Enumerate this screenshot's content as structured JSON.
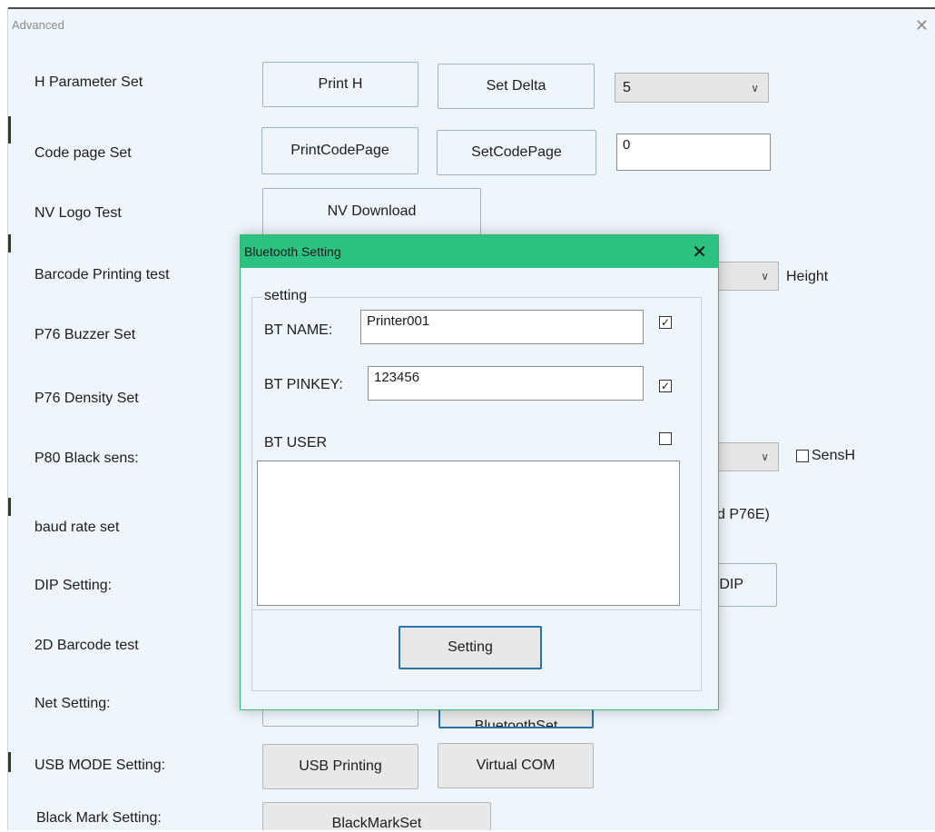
{
  "window": {
    "title": "Advanced",
    "close_glyph": "✕"
  },
  "rows": [
    {
      "label": "H Parameter Set"
    },
    {
      "label": "Code page Set"
    },
    {
      "label": "NV Logo Test"
    },
    {
      "label": "Barcode Printing test"
    },
    {
      "label": "P76 Buzzer Set"
    },
    {
      "label": "P76 Density Set"
    },
    {
      "label": "P80 Black sens:"
    },
    {
      "label": "baud rate set"
    },
    {
      "label": "DIP Setting:"
    },
    {
      "label": "2D Barcode test"
    },
    {
      "label": "Net Setting:"
    },
    {
      "label": "USB MODE Setting:"
    },
    {
      "label": "Black Mark Setting:"
    }
  ],
  "buttons": {
    "print_h": "Print H",
    "set_delta": "Set Delta",
    "print_code_page": "PrintCodePage",
    "set_code_page": "SetCodePage",
    "nv_download": "NV Download",
    "dip_partial": "DIP",
    "bluetooth_set_partial": "BluetoothSet",
    "usb_printing": "USB Printing",
    "virtual_com": "Virtual COM",
    "black_mark_set": "BlackMarkSet"
  },
  "fields": {
    "delta_value": "5",
    "code_page_value": "0",
    "height_label": "Height",
    "sensh_label": "SensH",
    "baud_partial": "d P76E)"
  },
  "icons": {
    "chevron": "∨",
    "check": "✓"
  },
  "dialog": {
    "title": "Bluetooth Setting",
    "close_glyph": "✕",
    "group_label": "setting",
    "bt_name_label": "BT NAME:",
    "bt_name_value": "Printer001",
    "bt_name_checked": true,
    "bt_pinkey_label": "BT PINKEY:",
    "bt_pinkey_value": "123456",
    "bt_pinkey_checked": true,
    "bt_user_label": "BT USER",
    "bt_user_checked": false,
    "setting_button": "Setting"
  },
  "colors": {
    "dialog_titlebar": "#2cc282",
    "window_bg": "#eef6fb",
    "focus_border": "#2a72a8"
  }
}
